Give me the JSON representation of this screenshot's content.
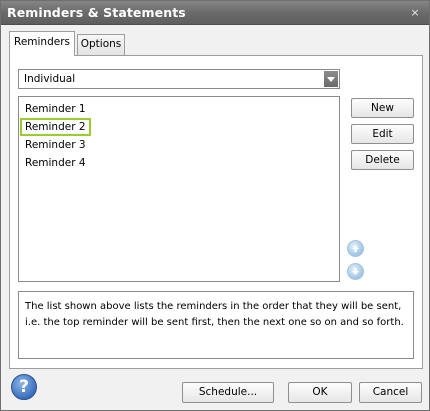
{
  "window": {
    "title": "Reminders & Statements",
    "close_glyph": "×"
  },
  "tabs": [
    {
      "label": "Reminders",
      "active": true
    },
    {
      "label": "Options",
      "active": false
    }
  ],
  "dropdown": {
    "value": "Individual"
  },
  "reminders": [
    "Reminder 1",
    "Reminder 2",
    "Reminder 3",
    "Reminder 4"
  ],
  "selected_reminder": "Reminder 2",
  "side_buttons": {
    "new": "New",
    "edit": "Edit",
    "delete": "Delete"
  },
  "description": "The list shown above lists the reminders in the order that they will be sent, i.e. the top reminder will be sent first, then the next one so on and so forth.",
  "help_glyph": "?",
  "footer_buttons": {
    "schedule": "Schedule...",
    "ok": "OK",
    "cancel": "Cancel"
  },
  "colors": {
    "selection_outline": "#9acd2c",
    "titlebar": "#6b6b6b"
  },
  "icons": {
    "move_up": "arrow-up-icon",
    "move_down": "arrow-down-icon",
    "help": "help-icon",
    "close": "close-icon",
    "dropdown": "chevron-down-icon"
  }
}
